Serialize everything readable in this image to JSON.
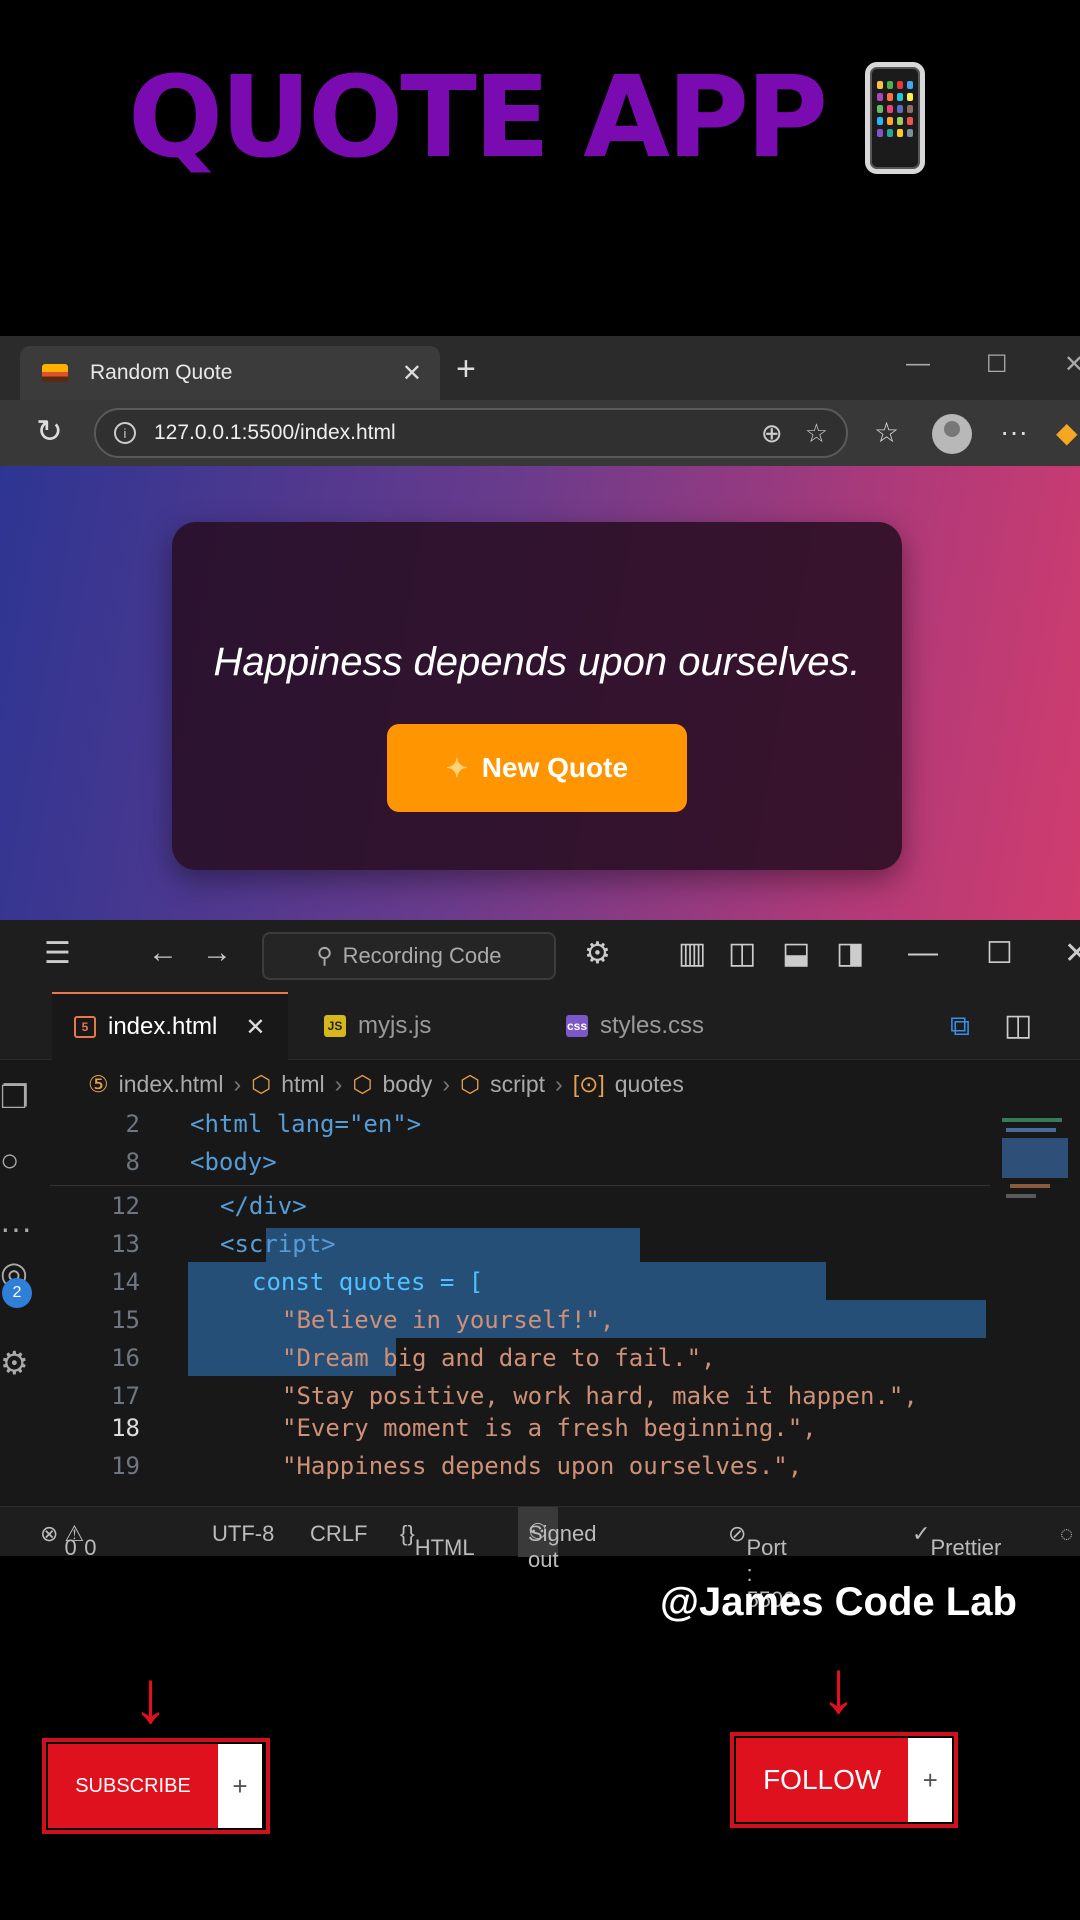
{
  "headline": {
    "text": "QUOTE APP"
  },
  "browser": {
    "tab_title": "Random Quote",
    "url": "127.0.0.1:5500/index.html"
  },
  "app": {
    "quote": "Happiness depends upon ourselves.",
    "button_label": "New Quote"
  },
  "editor": {
    "search_placeholder": "Recording Code",
    "tabs": [
      {
        "label": "index.html",
        "icon": "html-file-icon",
        "active": true
      },
      {
        "label": "myjs.js",
        "icon": "js-file-icon",
        "active": false
      },
      {
        "label": "styles.css",
        "icon": "css-file-icon",
        "active": false
      }
    ],
    "breadcrumbs": [
      "index.html",
      "html",
      "body",
      "script",
      "quotes"
    ],
    "lines": [
      {
        "num": "2",
        "text": "<html lang=\"en\">"
      },
      {
        "num": "8",
        "text": "<body>"
      },
      {
        "num": "12",
        "text": "</div>"
      },
      {
        "num": "13",
        "text": "<script>"
      },
      {
        "num": "14",
        "text": "const quotes = ["
      },
      {
        "num": "15",
        "text": "\"Believe in yourself!\","
      },
      {
        "num": "16",
        "text": "\"Dream big and dare to fail.\","
      },
      {
        "num": "17",
        "text": "\"Stay positive, work hard, make it happen.\","
      },
      {
        "num": "18",
        "text": "\"Every moment is a fresh beginning.\","
      },
      {
        "num": "19",
        "text": "\"Happiness depends upon ourselves.\","
      }
    ],
    "activity_badge": "2",
    "status": {
      "errors": "0",
      "warnings": "0",
      "encoding": "UTF-8",
      "eol": "CRLF",
      "language": "HTML",
      "account": "Signed out",
      "port": "Port : 5500",
      "formatter": "Prettier"
    }
  },
  "footer": {
    "handle": "@James Code Lab",
    "subscribe_label": "SUBSCRIBE",
    "follow_label": "FOLLOW",
    "plus": "+"
  },
  "colors": {
    "headline": "#7a0bb0",
    "button": "#ff9500",
    "cta_red": "#e0111e",
    "selection": "#264f78"
  }
}
